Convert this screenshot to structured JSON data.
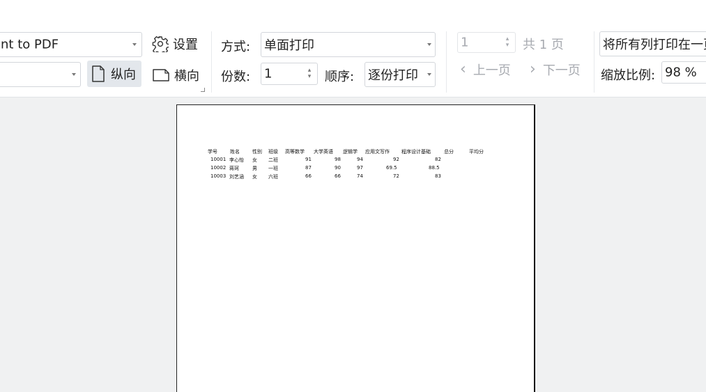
{
  "printer": {
    "name": "nt to PDF"
  },
  "paper": {
    "value": ""
  },
  "settings_button": {
    "label": "设置"
  },
  "orientation": {
    "portrait_label": "纵向",
    "landscape_label": "横向",
    "selected": "portrait"
  },
  "mode": {
    "label": "方式:",
    "value": "单面打印"
  },
  "copies": {
    "label": "份数:",
    "value": "1"
  },
  "order": {
    "label": "顺序:",
    "value": "逐份打印"
  },
  "pager": {
    "current": "1",
    "total_label": "共 1 页",
    "prev_label": "上一页",
    "next_label": "下一页"
  },
  "fit": {
    "value": "将所有列打印在一页"
  },
  "scale": {
    "label": "缩放比例:",
    "value": "98 %"
  },
  "preview": {
    "headers": [
      "学号",
      "姓名",
      "性别",
      "班级",
      "高等数学",
      "大学英语",
      "逻辑学",
      "应用文写作",
      "程序设计基础",
      "总分",
      "平均分"
    ],
    "rows": [
      [
        "10001",
        "李心怡",
        "女",
        "二班",
        "91",
        "98",
        "94",
        "92",
        "82",
        "",
        ""
      ],
      [
        "10002",
        "蒋珂",
        "男",
        "一班",
        "87",
        "90",
        "97",
        "69.5",
        "88.5",
        "",
        ""
      ],
      [
        "10003",
        "刘艺涵",
        "女",
        "六班",
        "66",
        "66",
        "74",
        "72",
        "83",
        "",
        ""
      ]
    ]
  }
}
